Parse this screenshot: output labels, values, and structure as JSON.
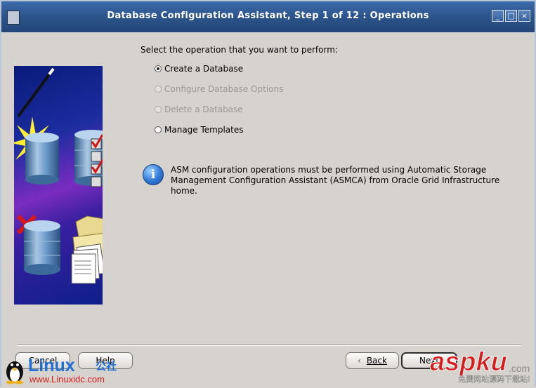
{
  "window": {
    "title": "Database Configuration Assistant, Step 1 of 12 : Operations",
    "controls": [
      "minimize",
      "maximize",
      "close"
    ]
  },
  "main": {
    "prompt": "Select the operation that you want to perform:",
    "options": [
      {
        "label": "Create a Database",
        "selected": true,
        "enabled": true
      },
      {
        "label": "Configure Database Options",
        "selected": false,
        "enabled": false
      },
      {
        "label": "Delete a Database",
        "selected": false,
        "enabled": false
      },
      {
        "label": "Manage Templates",
        "selected": false,
        "enabled": true
      }
    ],
    "info_icon": "info-icon",
    "info_line1": "ASM configuration operations must be performed using Automatic Storage",
    "info_line2": "Management Configuration Assistant (ASMCA) from Oracle Grid Infrastructure home."
  },
  "buttons": {
    "cancel": "Cancel",
    "help": "Help",
    "back": "Back",
    "next": "Next"
  },
  "watermarks": {
    "left_brand": "Linux",
    "left_brand_cn": "公社",
    "left_url": "www.Linuxidc.com",
    "right_brand": "aspku",
    "right_suffix": ".com",
    "right_caption": "免费网站源码下载站!"
  },
  "colors": {
    "title_bar": "#2a5186",
    "dialog_bg": "#d6d3ce",
    "info_blue": "#2f78d8",
    "watermark_red": "#d81c1c",
    "watermark_blue": "#1f6fd6"
  }
}
